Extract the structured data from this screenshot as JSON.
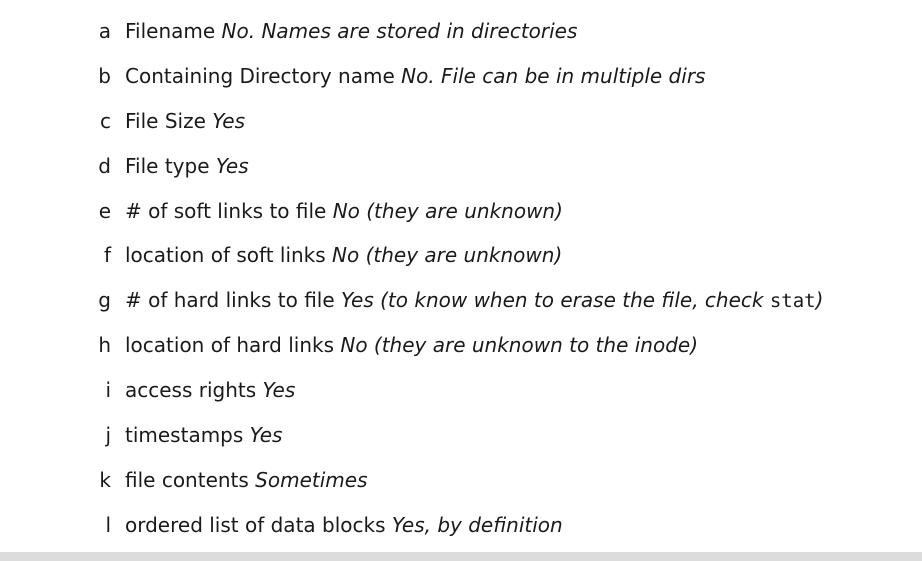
{
  "items": [
    {
      "marker": "a",
      "label": "Filename",
      "answer": "No. Names are stored in directories"
    },
    {
      "marker": "b",
      "label": "Containing Directory name",
      "answer": "No. File can be in multiple dirs"
    },
    {
      "marker": "c",
      "label": "File Size",
      "answer": "Yes"
    },
    {
      "marker": "d",
      "label": "File type",
      "answer": "Yes"
    },
    {
      "marker": "e",
      "label": "# of soft links to file",
      "answer": "No (they are unknown)"
    },
    {
      "marker": "f",
      "label": "location of soft links",
      "answer": "No (they are unknown)"
    },
    {
      "marker": "g",
      "label": "# of hard links to file",
      "answer": "Yes (to know when to erase the file, check",
      "code": "stat",
      "answer_tail": ")"
    },
    {
      "marker": "h",
      "label": "location of hard links",
      "answer": "No (they are unknown to the inode)"
    },
    {
      "marker": "i",
      "label": "access rights",
      "answer": "Yes"
    },
    {
      "marker": "j",
      "label": "timestamps",
      "answer": "Yes"
    },
    {
      "marker": "k",
      "label": "file contents",
      "answer": "Sometimes"
    },
    {
      "marker": "l",
      "label": "ordered list of data blocks",
      "answer": "Yes, by definition"
    }
  ]
}
